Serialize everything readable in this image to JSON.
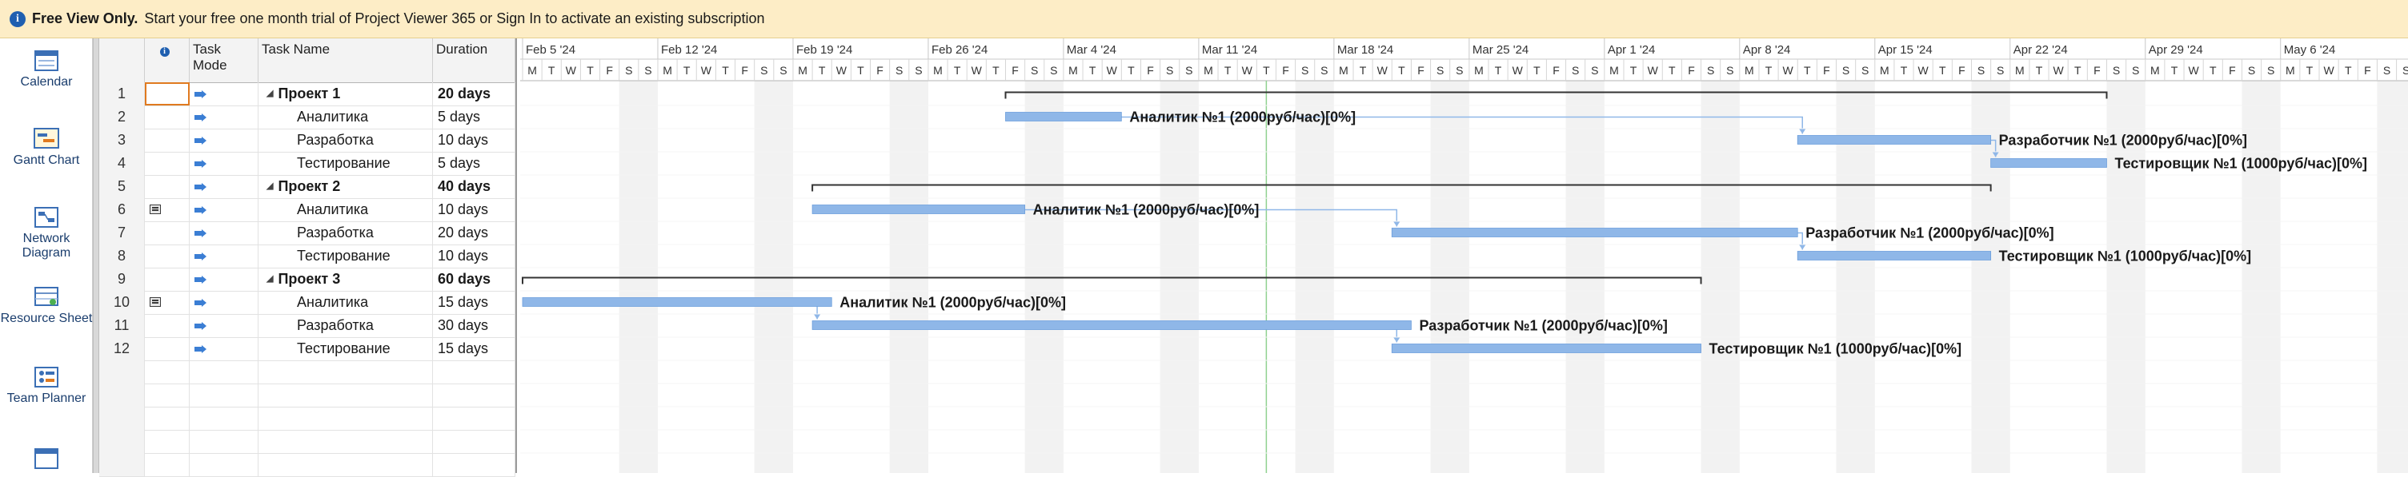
{
  "banner": {
    "title": "Free View Only.",
    "message": "Start your free one month trial of Project Viewer 365 or Sign In to activate an existing subscription"
  },
  "sidebar": {
    "items": [
      {
        "label": "Calendar",
        "icon": "calendar-icon"
      },
      {
        "label": "Gantt Chart",
        "icon": "gantt-chart-icon"
      },
      {
        "label": "Network Diagram",
        "icon": "network-diagram-icon"
      },
      {
        "label": "Resource Sheet",
        "icon": "resource-sheet-icon"
      },
      {
        "label": "Team Planner",
        "icon": "team-planner-icon"
      }
    ]
  },
  "table": {
    "headers": {
      "id": "",
      "indicators": "i",
      "mode": "Task Mode",
      "name": "Task Name",
      "duration": "Duration"
    },
    "rows": [
      {
        "id": "1",
        "name": "Проект 1",
        "duration": "20 days",
        "summary": true,
        "indicator": false
      },
      {
        "id": "2",
        "name": "Аналитика",
        "duration": "5 days",
        "summary": false,
        "indicator": false
      },
      {
        "id": "3",
        "name": "Разработка",
        "duration": "10 days",
        "summary": false,
        "indicator": false
      },
      {
        "id": "4",
        "name": "Тестирование",
        "duration": "5 days",
        "summary": false,
        "indicator": false
      },
      {
        "id": "5",
        "name": "Проект 2",
        "duration": "40 days",
        "summary": true,
        "indicator": false
      },
      {
        "id": "6",
        "name": "Аналитика",
        "duration": "10 days",
        "summary": false,
        "indicator": true
      },
      {
        "id": "7",
        "name": "Разработка",
        "duration": "20 days",
        "summary": false,
        "indicator": false
      },
      {
        "id": "8",
        "name": "Тестирование",
        "duration": "10 days",
        "summary": false,
        "indicator": false
      },
      {
        "id": "9",
        "name": "Проект 3",
        "duration": "60 days",
        "summary": true,
        "indicator": false
      },
      {
        "id": "10",
        "name": "Аналитика",
        "duration": "15 days",
        "summary": false,
        "indicator": true
      },
      {
        "id": "11",
        "name": "Разработка",
        "duration": "30 days",
        "summary": false,
        "indicator": false
      },
      {
        "id": "12",
        "name": "Тестирование",
        "duration": "15 days",
        "summary": false,
        "indicator": false
      }
    ]
  },
  "timeline": {
    "start_date": "Feb 5 '24",
    "weeks": [
      "Feb 5 '24",
      "Feb 12 '24",
      "Feb 19 '24",
      "Feb 26 '24",
      "Mar 4 '24",
      "Mar 11 '24",
      "Mar 18 '24",
      "Mar 25 '24",
      "Apr 1 '24",
      "Apr 8 '24",
      "Apr 15 '24",
      "Apr 22 '24",
      "Apr 29 '24",
      "May 6 '24"
    ],
    "day_letters": [
      "M",
      "T",
      "W",
      "T",
      "F",
      "S",
      "S"
    ],
    "today_date": "Mar 14 '24"
  },
  "gantt": {
    "tasks": [
      {
        "row": 1,
        "type": "summary",
        "start": "Mar 1 '24",
        "finish": "Apr 26 '24",
        "label": ""
      },
      {
        "row": 2,
        "type": "task",
        "start": "Mar 1 '24",
        "finish": "Mar 6 '24",
        "label": "Аналитик №1 (2000руб/час)[0%]"
      },
      {
        "row": 3,
        "type": "task",
        "start": "Apr 11 '24",
        "finish": "Apr 20 '24",
        "label": "Разработчик №1 (2000руб/час)[0%]"
      },
      {
        "row": 4,
        "type": "task",
        "start": "Apr 21 '24",
        "finish": "Apr 26 '24",
        "label": "Тестировщик №1 (1000руб/час)[0%]"
      },
      {
        "row": 5,
        "type": "summary",
        "start": "Feb 20 '24",
        "finish": "Apr 20 '24",
        "label": ""
      },
      {
        "row": 6,
        "type": "task",
        "start": "Feb 20 '24",
        "finish": "Mar 1 '24",
        "label": "Аналитик №1 (2000руб/час)[0%]"
      },
      {
        "row": 7,
        "type": "task",
        "start": "Mar 21 '24",
        "finish": "Apr 10 '24",
        "label": "Разработчик №1 (2000руб/час)[0%]"
      },
      {
        "row": 8,
        "type": "task",
        "start": "Apr 11 '24",
        "finish": "Apr 20 '24",
        "label": "Тестировщик №1 (1000руб/час)[0%]"
      },
      {
        "row": 9,
        "type": "summary",
        "start": "Feb 5 '24",
        "finish": "Apr 5 '24",
        "label": ""
      },
      {
        "row": 10,
        "type": "task",
        "start": "Feb 5 '24",
        "finish": "Feb 20 '24",
        "label": "Аналитик №1 (2000руб/час)[0%]"
      },
      {
        "row": 11,
        "type": "task",
        "start": "Feb 20 '24",
        "finish": "Mar 21 '24",
        "label": "Разработчик №1 (2000руб/час)[0%]"
      },
      {
        "row": 12,
        "type": "task",
        "start": "Mar 21 '24",
        "finish": "Apr 5 '24",
        "label": "Тестировщик №1 (1000руб/час)[0%]"
      }
    ],
    "links": [
      {
        "from_row": 2,
        "to_row": 3
      },
      {
        "from_row": 3,
        "to_row": 4
      },
      {
        "from_row": 6,
        "to_row": 7
      },
      {
        "from_row": 7,
        "to_row": 8
      },
      {
        "from_row": 10,
        "to_row": 11
      },
      {
        "from_row": 11,
        "to_row": 12
      }
    ]
  },
  "colors": {
    "bar": "#8fb7e8",
    "bar_edge": "#6d9fdc",
    "summary": "#333333",
    "weekend_shade": "#f2f2f2",
    "today_line": "#8fd18f",
    "link": "#8fb7e8",
    "banner_bg": "#fdedc6"
  }
}
